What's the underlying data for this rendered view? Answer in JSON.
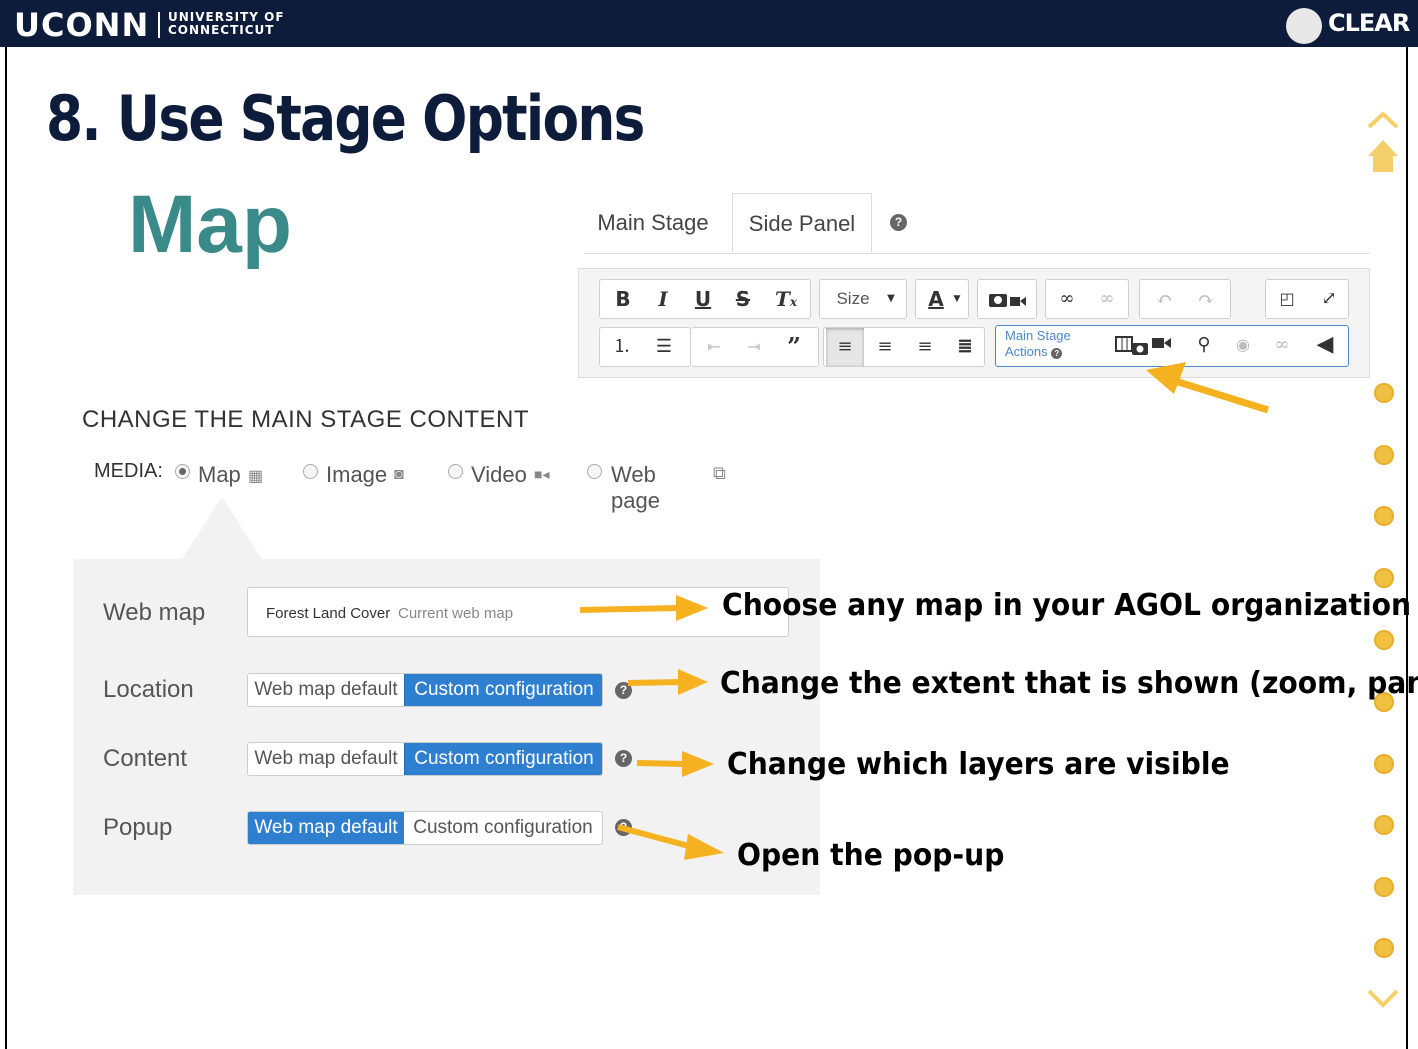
{
  "header": {
    "logo_text": "UCONN",
    "logo_sub_line1": "UNIVERSITY OF",
    "logo_sub_line2": "CONNECTICUT",
    "brand_right": "CLEAR"
  },
  "slide": {
    "title": "8. Use Stage Options",
    "subtitle": "Map"
  },
  "editor": {
    "tabs": [
      {
        "label": "Main Stage",
        "active": false
      },
      {
        "label": "Side Panel",
        "active": true
      }
    ],
    "help_glyph": "?",
    "toolbar": {
      "size_label": "Size",
      "font_color_label": "A",
      "stage_actions_label_line1": "Main Stage",
      "stage_actions_label_line2": "Actions",
      "row1_icons": [
        "bold-icon",
        "italic-icon",
        "underline-icon",
        "strikethrough-icon",
        "clear-format-icon",
        "size-dropdown",
        "font-color-icon",
        "media-insert-icon",
        "link-icon",
        "unlink-icon",
        "undo-icon",
        "redo-icon",
        "source-icon",
        "fullscreen-icon"
      ],
      "row2_icons": [
        "numbered-list-icon",
        "bulleted-list-icon",
        "outdent-icon",
        "indent-icon",
        "blockquote-icon",
        "align-left-icon",
        "align-center-icon",
        "align-right-icon",
        "justify-icon",
        "map-action-icon",
        "media-action-icon",
        "location-action-icon",
        "eye-icon",
        "unlink-icon",
        "collapse-icon"
      ]
    }
  },
  "section": {
    "heading": "CHANGE THE MAIN STAGE CONTENT",
    "media_label": "MEDIA:",
    "media_options": [
      {
        "label": "Map",
        "selected": true
      },
      {
        "label": "Image",
        "selected": false
      },
      {
        "label": "Video",
        "selected": false
      },
      {
        "label": "Web page",
        "selected": false
      }
    ]
  },
  "panel": {
    "webmap": {
      "label": "Web map",
      "value": "Forest Land Cover",
      "hint": "Current web map"
    },
    "location": {
      "label": "Location",
      "option_a": "Web map default",
      "option_b": "Custom configuration",
      "selected": "option_b"
    },
    "content": {
      "label": "Content",
      "option_a": "Web map default",
      "option_b": "Custom configuration",
      "selected": "option_b"
    },
    "popup": {
      "label": "Popup",
      "option_a": "Web map default",
      "option_b": "Custom configuration",
      "selected": "option_a"
    }
  },
  "callouts": {
    "webmap": "Choose any map in your AGOL organization",
    "location": "Change the extent that is shown (zoom, pan)",
    "content": "Change which layers are visible",
    "popup": "Open the pop-up"
  },
  "colors": {
    "navy": "#0d1c3a",
    "teal": "#3a8a8a",
    "arrow": "#f5b120",
    "selected_blue": "#2f7fd0",
    "nav_dot": "#f0c040"
  }
}
